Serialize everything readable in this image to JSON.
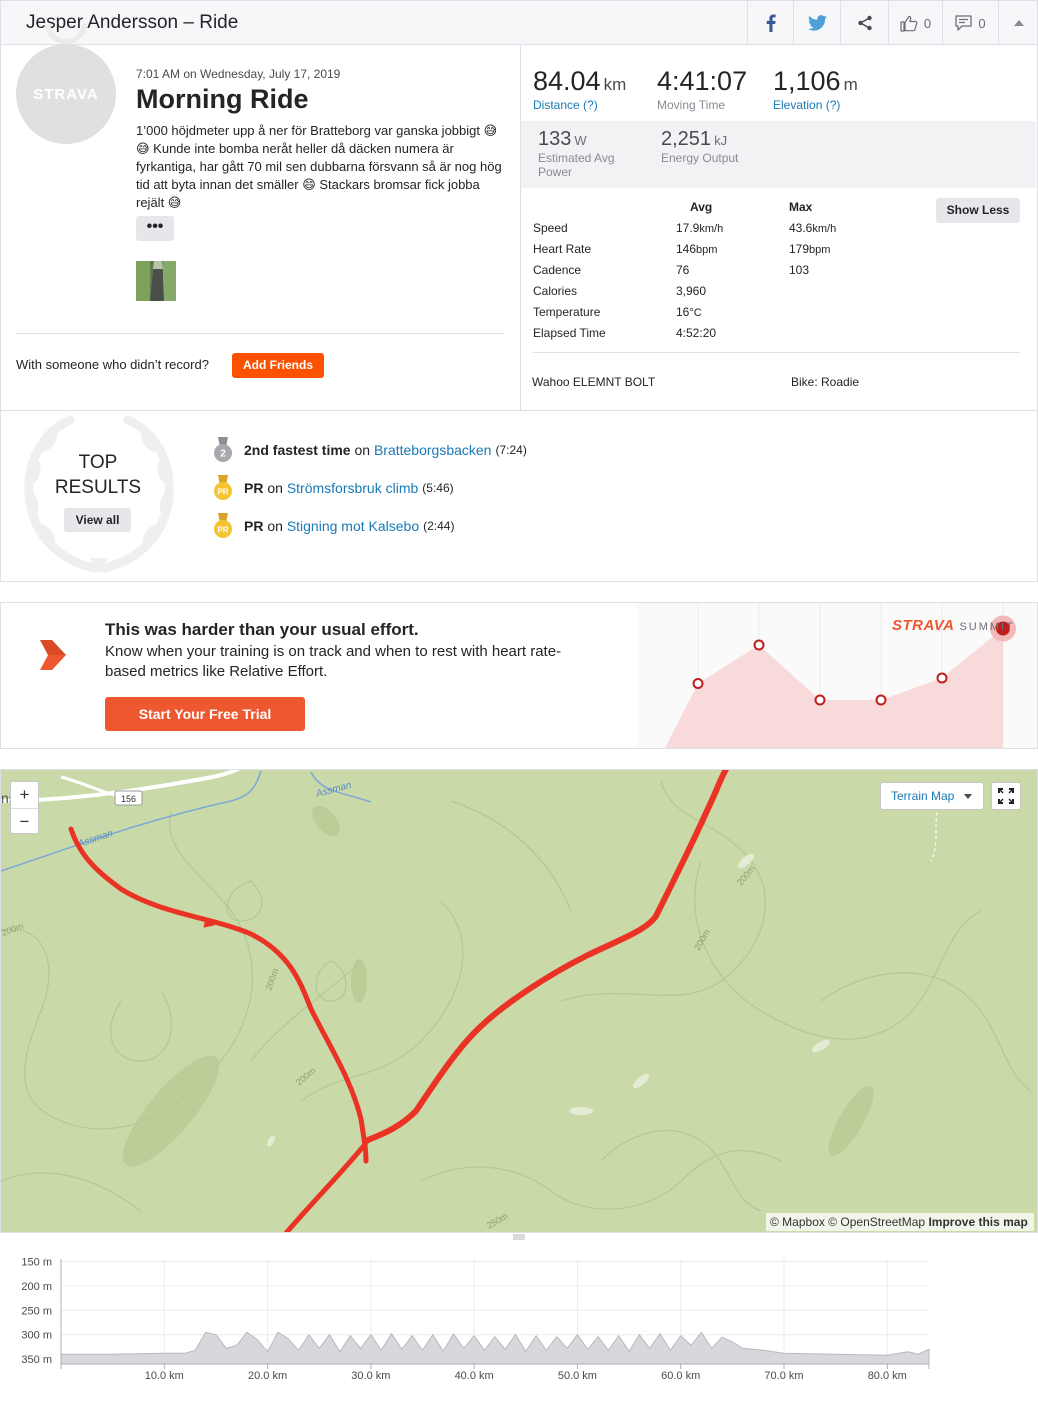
{
  "header": {
    "title": "Jesper Andersson – Ride",
    "kudos_count": "0",
    "comment_count": "0"
  },
  "activity": {
    "avatar_text": "STRAVA",
    "date": "7:01 AM on Wednesday, July 17, 2019",
    "title": "Morning Ride",
    "description": "1’000 höjdmeter upp å ner för Bratteborg var ganska jobbigt 😅😅 Kunde inte bomba neråt heller då däcken numera är fyrkantiga, har gått 70 mil sen dubbarna försvann så är nog hög tid att byta innan det smäller 😄 Stackars bromsar fick jobba rejält 😅",
    "more_label": "•••",
    "with_someone": "With someone who didn’t record?",
    "add_friends": "Add Friends"
  },
  "stats": {
    "distance": {
      "value": "84.04",
      "unit": "km",
      "label": "Distance (?)"
    },
    "moving_time": {
      "value": "4:41:07",
      "label": "Moving Time"
    },
    "elevation": {
      "value": "1,106",
      "unit": "m",
      "label": "Elevation (?)"
    },
    "power": {
      "value": "133",
      "unit": "W",
      "label1": "Estimated Avg",
      "label2": "Power"
    },
    "energy": {
      "value": "2,251",
      "unit": "kJ",
      "label": "Energy Output"
    }
  },
  "more_stats": {
    "avg_header": "Avg",
    "max_header": "Max",
    "show_less": "Show Less",
    "rows": [
      {
        "label": "Speed",
        "avg": "17.9",
        "avg_unit": "km/h",
        "max": "43.6",
        "max_unit": "km/h"
      },
      {
        "label": "Heart Rate",
        "avg": "146",
        "avg_unit": "bpm",
        "max": "179",
        "max_unit": "bpm"
      },
      {
        "label": "Cadence",
        "avg": "76",
        "avg_unit": "",
        "max": "103",
        "max_unit": ""
      },
      {
        "label": "Calories",
        "avg": "3,960",
        "avg_unit": "",
        "max": "",
        "max_unit": ""
      },
      {
        "label": "Temperature",
        "avg": "16",
        "avg_unit": "°C",
        "max": "",
        "max_unit": ""
      },
      {
        "label": "Elapsed Time",
        "avg": "4:52:20",
        "avg_unit": "",
        "max": "",
        "max_unit": ""
      }
    ],
    "device": "Wahoo ELEMNT BOLT",
    "bike": "Bike: Roadie"
  },
  "top_results": {
    "title_line1": "TOP",
    "title_line2": "RESULTS",
    "view_all": "View all",
    "achievements": [
      {
        "badge": "2",
        "lead": "2nd fastest time",
        "on": " on ",
        "segment": "Bratteborgsbacken",
        "time": "(7:24)"
      },
      {
        "badge": "PR",
        "lead": "PR",
        "on": " on ",
        "segment": "Strömsforsbruk climb",
        "time": "(5:46)"
      },
      {
        "badge": "PR",
        "lead": "PR",
        "on": " on ",
        "segment": "Stigning mot Kalsebo",
        "time": "(2:44)"
      }
    ]
  },
  "promo": {
    "heading": "This was harder than your usual effort.",
    "body": "Know when your training is on track and when to rest with heart rate-based metrics like Relative Effort.",
    "cta": "Start Your Free Trial",
    "logo_brand": "STRAVA",
    "logo_product": "SUMMIT"
  },
  "map": {
    "zoom_in": "+",
    "zoom_out": "−",
    "layer": "Terrain Map",
    "road_badge": "156",
    "river_label": "Assman",
    "place_fragment": "ns",
    "contour_labels": [
      "200m",
      "200m",
      "200m",
      "200m",
      "200m",
      "250m"
    ],
    "attribution_mapbox": "© Mapbox",
    "attribution_osm": "© OpenStreetMap",
    "attribution_improve": "Improve this map"
  },
  "elevation_chart": {
    "y_ticks": [
      "350 m",
      "300 m",
      "250 m",
      "200 m",
      "150 m"
    ],
    "x_ticks": [
      "10.0 km",
      "20.0 km",
      "30.0 km",
      "40.0 km",
      "50.0 km",
      "60.0 km",
      "70.0 km",
      "80.0 km"
    ]
  },
  "chart_data": {
    "type": "area",
    "title": "",
    "xlabel": "",
    "ylabel": "",
    "x_unit": "km",
    "y_unit": "m",
    "xlim": [
      0,
      84.04
    ],
    "ylim": [
      140,
      355
    ],
    "y_ticks": [
      150,
      200,
      250,
      300,
      350
    ],
    "x_ticks": [
      10,
      20,
      30,
      40,
      50,
      60,
      70,
      80
    ],
    "grid": true,
    "series": [
      {
        "x": [
          0,
          5,
          10,
          12,
          13,
          14,
          15,
          16,
          17,
          18,
          19,
          20,
          21,
          22,
          23,
          24,
          25,
          26,
          27,
          28,
          29,
          30,
          31,
          32,
          33,
          34,
          35,
          36,
          37,
          38,
          39,
          40,
          41,
          42,
          43,
          44,
          45,
          46,
          47,
          48,
          49,
          50,
          51,
          52,
          53,
          54,
          55,
          56,
          57,
          58,
          59,
          60,
          61,
          62,
          63,
          64,
          65,
          66,
          67,
          68,
          70,
          75,
          80,
          82,
          83,
          84.04
        ],
        "y": [
          160,
          160,
          162,
          162,
          168,
          205,
          200,
          172,
          178,
          205,
          190,
          165,
          205,
          192,
          168,
          200,
          172,
          200,
          165,
          198,
          172,
          200,
          168,
          202,
          170,
          198,
          168,
          200,
          166,
          202,
          172,
          198,
          168,
          196,
          170,
          200,
          166,
          198,
          168,
          196,
          172,
          200,
          170,
          196,
          168,
          198,
          166,
          200,
          172,
          202,
          168,
          198,
          178,
          205,
          172,
          195,
          185,
          172,
          170,
          168,
          162,
          160,
          158,
          165,
          160,
          170
        ]
      }
    ]
  },
  "promo_graph_data": {
    "type": "line",
    "values": [
      0.45,
      0.8,
      0.3,
      0.3,
      0.5,
      0.95
    ]
  }
}
